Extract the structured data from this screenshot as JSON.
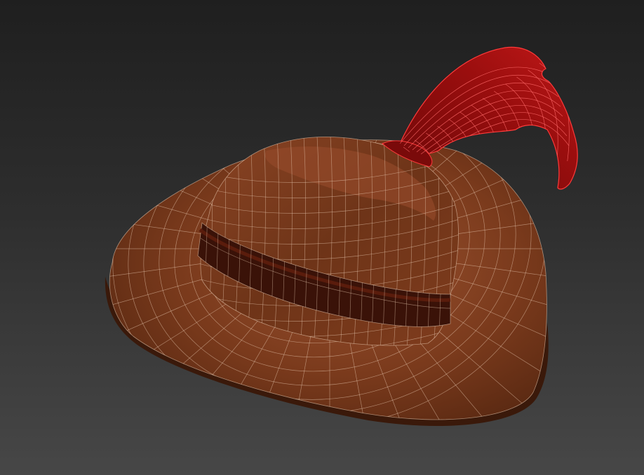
{
  "viewport": {
    "background_top": "#1f1f1f",
    "background_bottom": "#474747"
  },
  "model": {
    "subject": "hat",
    "display_mode": "shaded-with-wireframe",
    "wire_color": "#e8c9b0",
    "materials": {
      "hat": "#7a3a1c",
      "hat_light": "#9b5230",
      "hat_dark": "#4a1f0c",
      "band": "#3a1208",
      "feather": "#8a0c0c",
      "feather_light": "#c01818",
      "feather_wire": "#ff3a3a"
    }
  }
}
